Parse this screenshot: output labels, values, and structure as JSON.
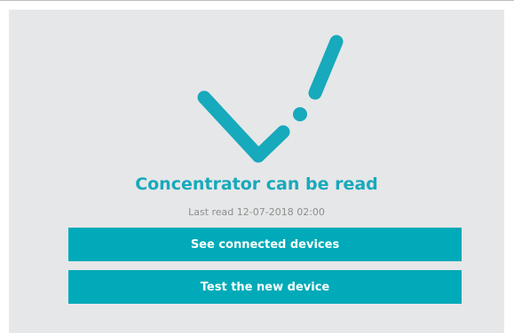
{
  "status": {
    "title": "Concentrator can be read",
    "last_read": "Last read 12-07-2018 02:00",
    "icon": "check-icon"
  },
  "actions": {
    "see_devices_label": "See connected devices",
    "test_device_label": "Test the new device"
  },
  "colors": {
    "accent": "#00aab8",
    "panel_background": "#e6e7e8",
    "subtitle_text": "#8d8d8d",
    "button_text": "#ffffff"
  }
}
